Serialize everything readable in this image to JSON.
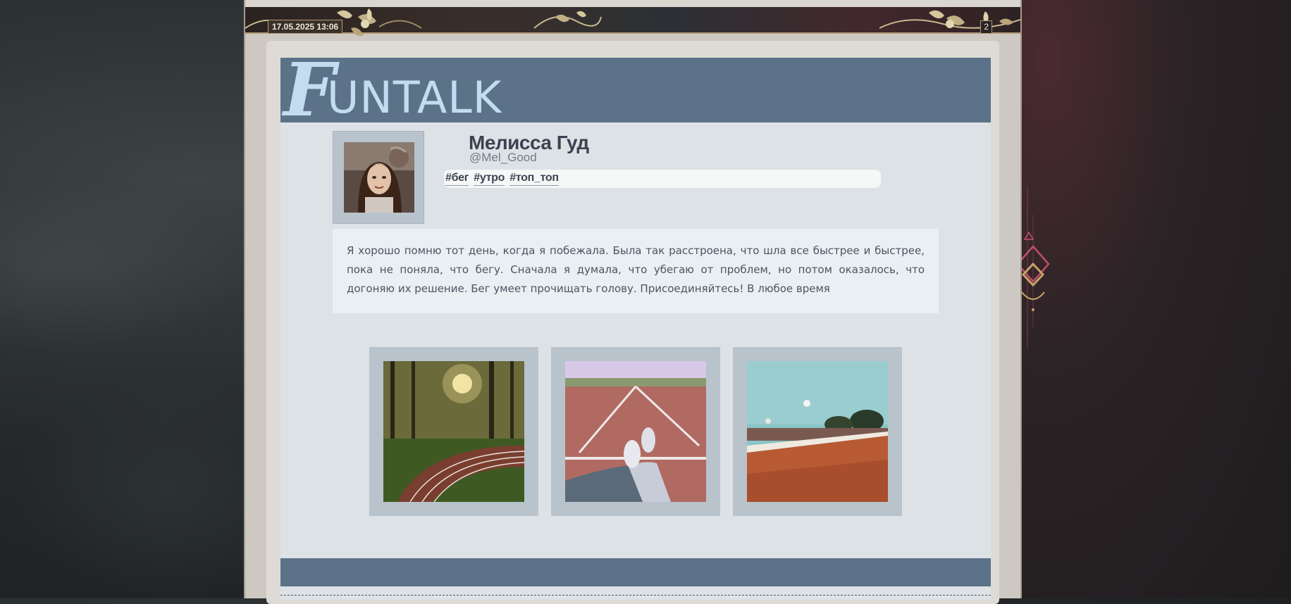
{
  "post": {
    "date": "17.05.2025 13:06",
    "number": "2"
  },
  "logo": {
    "initial": "F",
    "rest": "UNTALK"
  },
  "user": {
    "name": "Мелисса Гуд",
    "handle": "@Mel_Good"
  },
  "tags": [
    "#бег",
    "#утро",
    "#топ_топ"
  ],
  "text": "Я хорошо помню тот день, когда я побежала. Была так расстроена, что шла все быстрее и быстрее, пока не поняла, что бегу. Сначала я думала, что убегаю от проблем, но потом оказалось, что догоняю их решение. Бег умеет прочищать голову. Присоединяйтесь! В любое время",
  "colors": {
    "header": "#5c7288",
    "logo": "#c3dcf0",
    "card": "#dde2e6",
    "frame": "#b8c3cc"
  },
  "icons": {
    "ornament_left": "floral-ornament-icon",
    "ornament_right": "floral-ornament-icon",
    "side_decoration": "diamond-ornament-icon"
  }
}
